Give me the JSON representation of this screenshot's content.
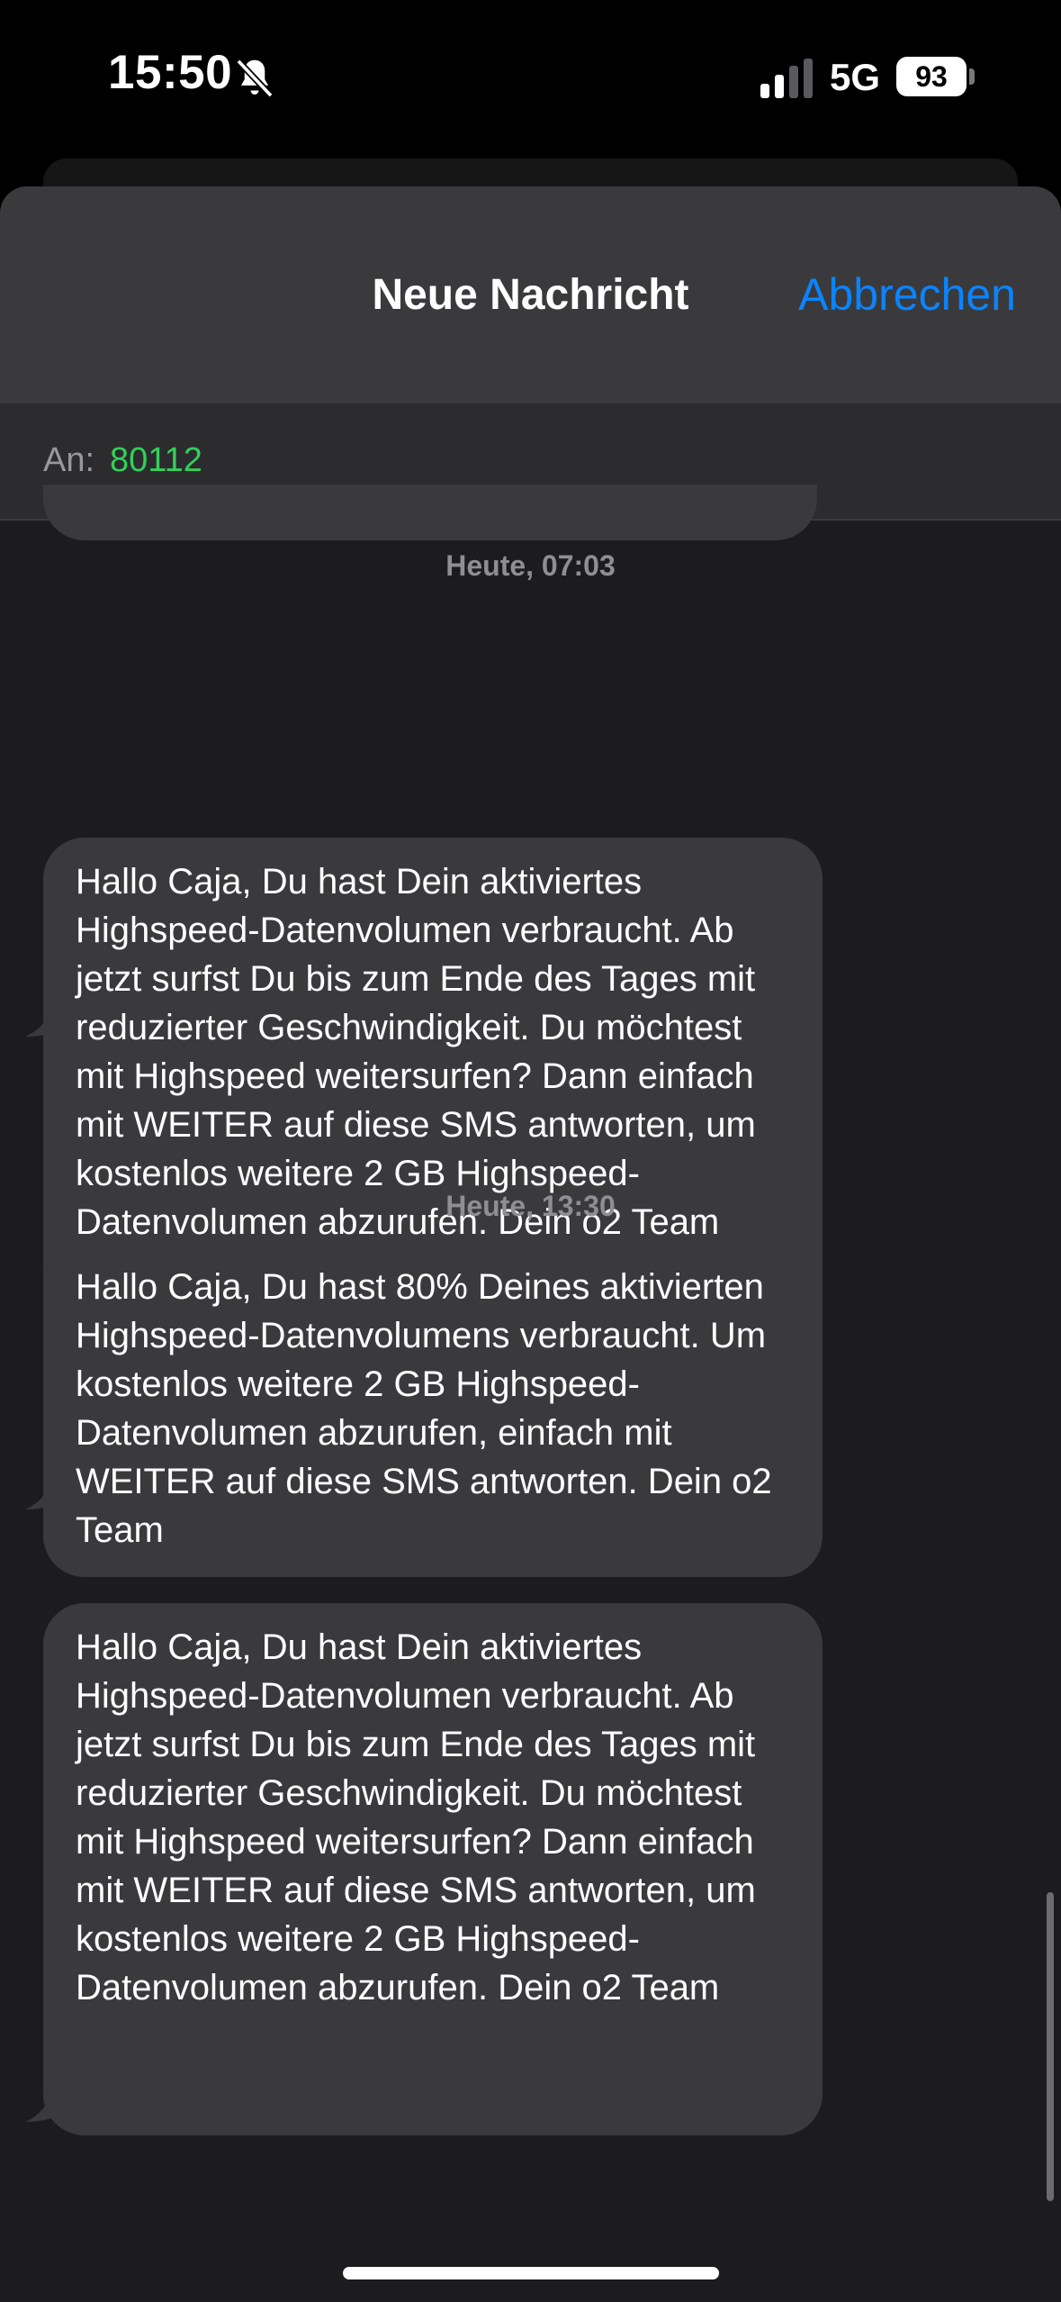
{
  "status_bar": {
    "time": "15:50",
    "network": "5G",
    "battery": "93",
    "icons": [
      "bell-slash-icon",
      "cellular-signal-icon"
    ]
  },
  "sheet": {
    "title": "Neue Nachricht",
    "cancel_label": "Abbrechen"
  },
  "recipient": {
    "label": "An:",
    "value": "80112"
  },
  "messages": [
    {
      "timestamp": "Heute, 07:03",
      "text": "Hallo Caja, Du hast Dein aktiviertes Highspeed-Datenvolumen verbraucht. Ab jetzt surfst Du bis zum Ende des Tages mit reduzierter Geschwindig­keit. Du möchtest mit Highspeed weitersurfen? Dann einfach mit WEITER auf diese SMS antworten, um kostenlos weitere 2 GB Highspeed-Datenvolumen abzurufen. Dein o2 Team"
    },
    {
      "timestamp": "Heute, 13:30",
      "text": "Hallo Caja, Du hast 80% Deines aktivierten Highspeed-Datenvolumens verbraucht. Um kostenlos weitere 2 GB Highspeed-Datenvolumen abzurufen, einfach mit WEITER auf diese SMS antworten. Dein o2 Team"
    },
    {
      "timestamp": "",
      "text": "Hallo Caja, Du hast Dein aktiviertes Highspeed-Datenvolumen verbraucht. Ab jetzt surfst Du bis zum Ende des Tages mit reduzierter Geschwindig­keit. Du möchtest mit Highspeed weitersurfen? Dann einfach mit WEITER auf diese SMS antworten, um kostenlos weitere 2 GB Highspeed-Datenvolumen abzurufen. Dein o2 Team"
    }
  ],
  "colors": {
    "accent": "#0a84ff",
    "recipient": "#30d158",
    "bubble": "#3a3a3c",
    "background": "#1c1c1e"
  }
}
